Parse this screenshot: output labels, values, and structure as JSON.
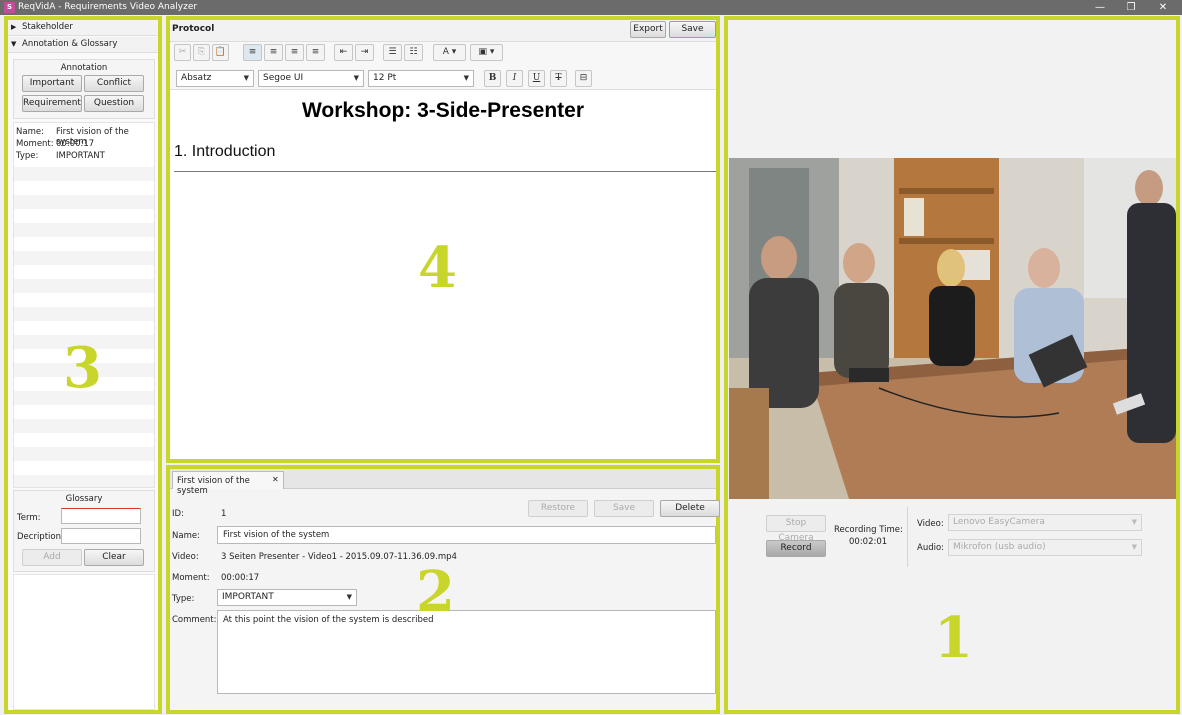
{
  "window": {
    "title": "ReqVidA - Requirements Video Analyzer",
    "icon": "reqvida-app-icon",
    "minimize": "—",
    "maximize": "❐",
    "close": "✕"
  },
  "left_panel": {
    "stakeholder": "Stakeholder",
    "annotation_glossary": "Annotation & Glossary",
    "annotation_title": "Annotation",
    "buttons": {
      "important": "Important",
      "conflict": "Conflict",
      "requirement": "Requirement",
      "question": "Question"
    },
    "details": {
      "name_label": "Name:",
      "name_value": "First vision of the system",
      "moment_label": "Moment:",
      "moment_value": "00:00:17",
      "type_label": "Type:",
      "type_value": "IMPORTANT"
    },
    "glossary": {
      "title": "Glossary",
      "term_label": "Term:",
      "description_label": "Decription:",
      "add": "Add",
      "clear": "Clear",
      "term_value": "",
      "description_value": ""
    }
  },
  "protocol": {
    "title": "Protocol",
    "export": "Export",
    "save": "Save",
    "style_select": "Absatz",
    "font_select": "Segoe UI",
    "size_select": "12 Pt",
    "bold": "B",
    "italic": "I",
    "underline": "U",
    "strike": "T",
    "heading": "Workshop: 3-Side-Presenter",
    "section": "1. Introduction"
  },
  "annotation_editor": {
    "tab_label": "First vision of the system",
    "tab_close": "✕",
    "restore": "Restore",
    "save": "Save",
    "delete": "Delete",
    "id_label": "ID:",
    "id_value": "1",
    "name_label": "Name:",
    "name_value": "First vision of the system",
    "video_label": "Video:",
    "video_value": "3 Seiten Presenter - Video1 - 2015.09.07-11.36.09.mp4",
    "moment_label": "Moment:",
    "moment_value": "00:00:17",
    "type_label": "Type:",
    "type_value": "IMPORTANT",
    "comment_label": "Comment:",
    "comment_value": "At this point the vision of the system is described"
  },
  "video_panel": {
    "stop_camera": "Stop Camera",
    "record": "Record",
    "recording_time_label": "Recording Time:",
    "recording_time_value": "00:02:01",
    "video_label": "Video:",
    "video_value": "Lenovo EasyCamera",
    "audio_label": "Audio:",
    "audio_value": "Mikrofon (usb audio)"
  },
  "overlay_numbers": {
    "one": "1",
    "two": "2",
    "three": "3",
    "four": "4"
  },
  "colors": {
    "highlight": "#c8d52a",
    "titlebar": "#6b6b6b"
  }
}
